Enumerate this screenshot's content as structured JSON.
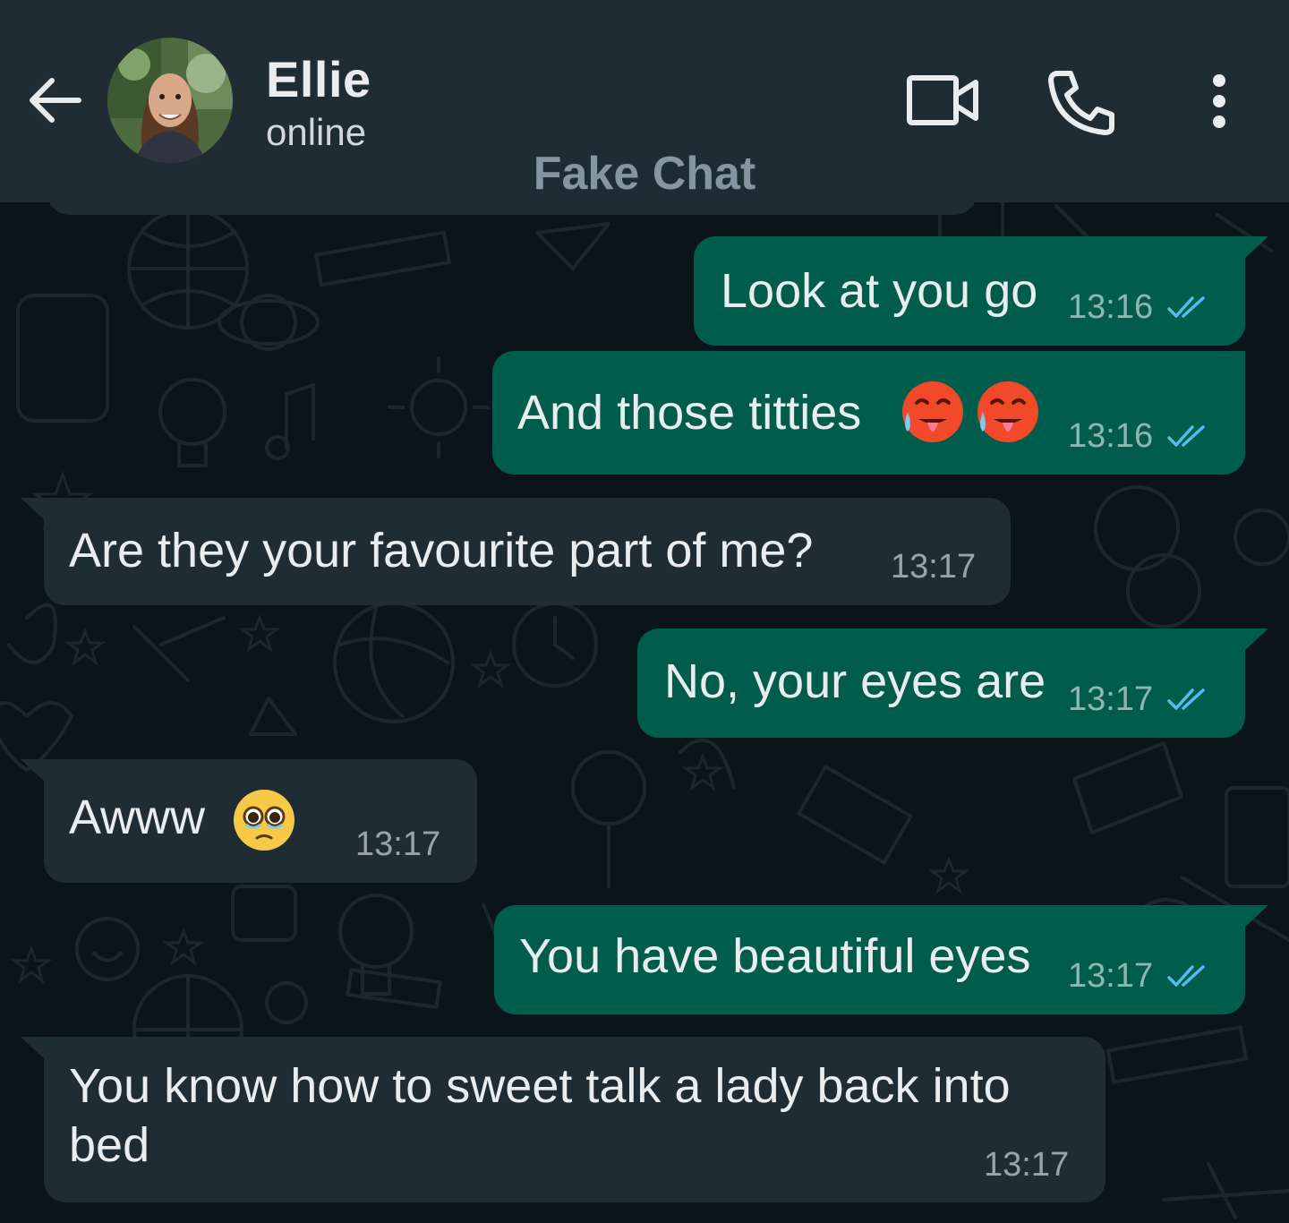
{
  "header": {
    "back_icon": "arrow-left-icon",
    "contact_name": "Ellie",
    "contact_status": "online",
    "watermark": "Fake Chat",
    "actions": [
      "video-camera-icon",
      "phone-icon",
      "more-vertical-icon"
    ]
  },
  "messages": [
    {
      "direction": "out",
      "text": "Look at you go",
      "time": "13:16",
      "status": "read"
    },
    {
      "direction": "out",
      "text": "And those titties",
      "emoji": [
        "hot-face-emoji",
        "hot-face-emoji"
      ],
      "time": "13:16",
      "status": "read"
    },
    {
      "direction": "in",
      "text": "Are they your favourite part of me?",
      "time": "13:17"
    },
    {
      "direction": "out",
      "text": "No, your eyes are",
      "time": "13:17",
      "status": "read"
    },
    {
      "direction": "in",
      "text": "Awww",
      "emoji": [
        "pleading-face-emoji"
      ],
      "time": "13:17"
    },
    {
      "direction": "out",
      "text": "You have beautiful eyes",
      "time": "13:17",
      "status": "read"
    },
    {
      "direction": "in",
      "text": "You know how to sweet talk a lady back into bed",
      "time": "13:17"
    }
  ],
  "colors": {
    "header_bg": "#1f2c34",
    "chat_bg": "#0b141a",
    "outgoing_bubble": "#005c4b",
    "incoming_bubble": "#1f2c34",
    "read_tick": "#53bdeb",
    "primary_text": "#e9edef"
  }
}
